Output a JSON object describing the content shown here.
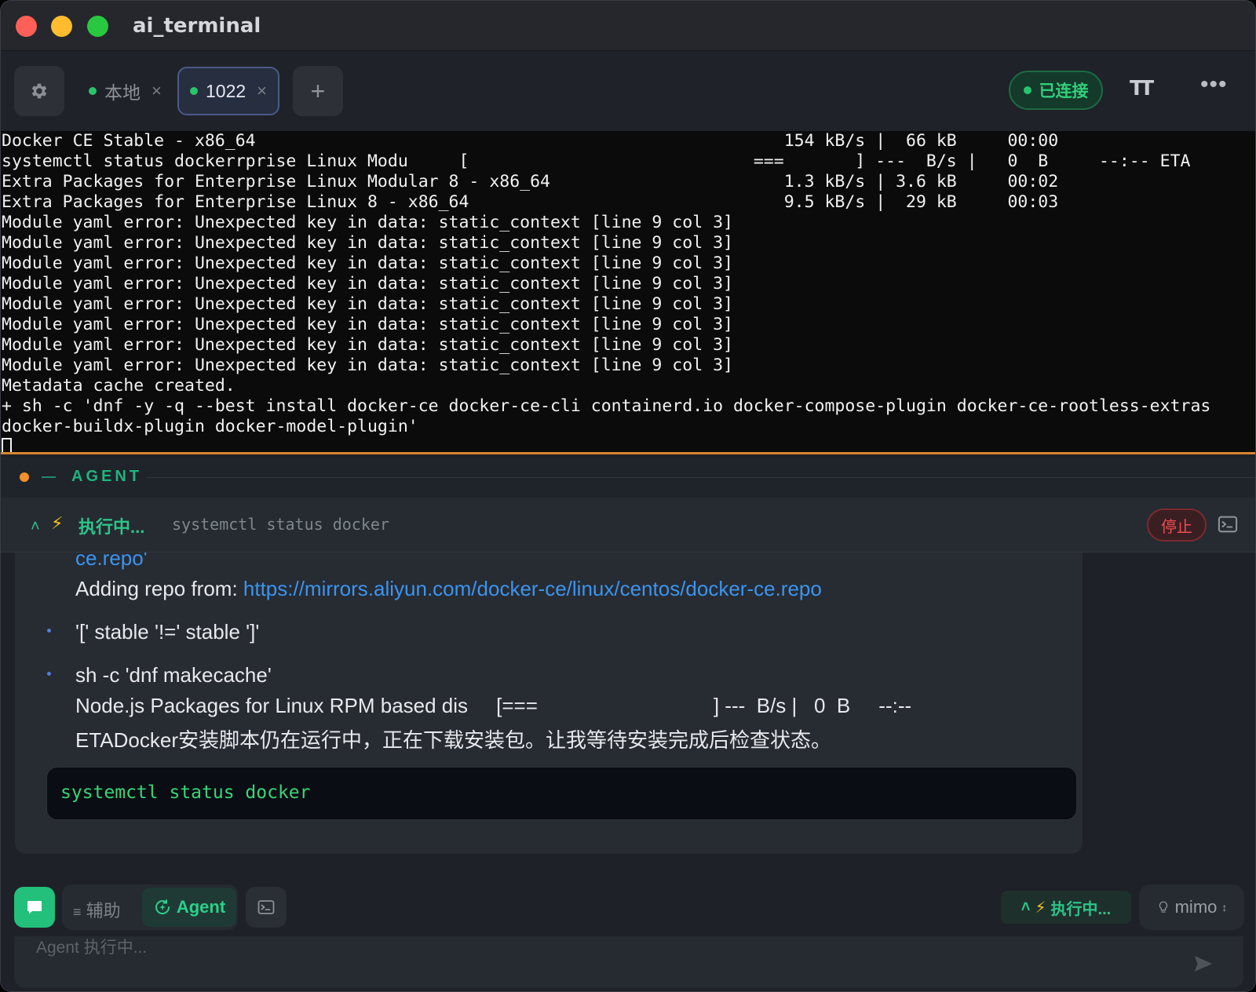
{
  "window": {
    "title": "ai_terminal"
  },
  "tabs": [
    {
      "label": "本地",
      "active": false
    },
    {
      "label": "1022",
      "active": true
    }
  ],
  "tab_close_glyph": "×",
  "add_tab_glyph": "+",
  "connection": {
    "status": "已连接",
    "color": "#31d07a"
  },
  "toolbar": {
    "font_icon": "font-size-icon",
    "font_glyph": "TT",
    "more_glyph": "•••"
  },
  "terminal": {
    "lines": [
      "Docker CE Stable - x86_64                                                    154 kB/s |  66 kB     00:00",
      "systemctl status dockerrprise Linux Modu     [                            ===       ] ---  B/s |   0  B     --:-- ETA",
      "Extra Packages for Enterprise Linux Modular 8 - x86_64                       1.3 kB/s | 3.6 kB     00:02",
      "Extra Packages for Enterprise Linux 8 - x86_64                               9.5 kB/s |  29 kB     00:03",
      "Module yaml error: Unexpected key in data: static_context [line 9 col 3]",
      "Module yaml error: Unexpected key in data: static_context [line 9 col 3]",
      "Module yaml error: Unexpected key in data: static_context [line 9 col 3]",
      "Module yaml error: Unexpected key in data: static_context [line 9 col 3]",
      "Module yaml error: Unexpected key in data: static_context [line 9 col 3]",
      "Module yaml error: Unexpected key in data: static_context [line 9 col 3]",
      "Module yaml error: Unexpected key in data: static_context [line 9 col 3]",
      "Module yaml error: Unexpected key in data: static_context [line 9 col 3]",
      "Metadata cache created.",
      "+ sh -c 'dnf -y -q --best install docker-ce docker-ce-cli containerd.io docker-compose-plugin docker-ce-rootless-extras",
      "docker-buildx-plugin docker-model-plugin'"
    ]
  },
  "agent": {
    "title": "AGENT",
    "exec_label": "执行中...",
    "exec_command": "systemctl status docker",
    "stop_label": "停止"
  },
  "message": {
    "repo_tail": "ce.repo'",
    "adding_repo_prefix": "Adding repo from: ",
    "adding_repo_url": "https://mirrors.aliyun.com/docker-ce/linux/centos/docker-ce.repo",
    "bullet1": "'[' stable '!=' stable ']'",
    "bullet2": "sh -c 'dnf makecache'",
    "progress_line": "Node.js Packages for Linux RPM based dis     [===                               ] ---  B/s |   0  B     --:--",
    "status_line": "ETADocker安装脚本仍在运行中，正在下载安装包。让我等待安装完成后检查状态。",
    "code": "systemctl status docker"
  },
  "input": {
    "mode_assist": "辅助",
    "mode_agent": "Agent",
    "exec_status": "执行中...",
    "model": "mimo",
    "placeholder": "Agent 执行中..."
  }
}
